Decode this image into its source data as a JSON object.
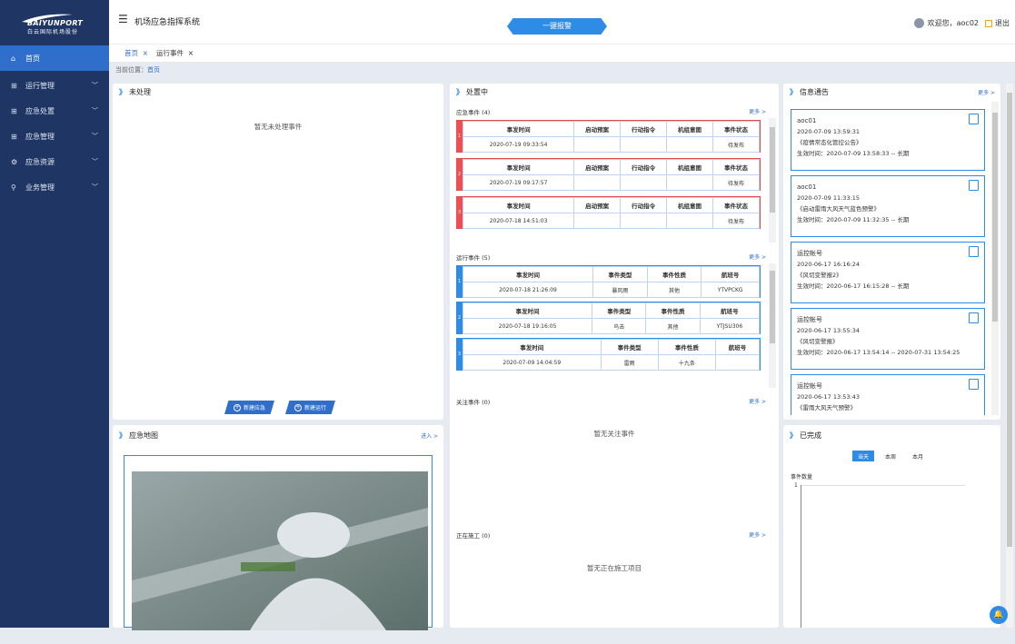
{
  "brand": {
    "logo_en": "BAIYUNPORT",
    "logo_cn": "白云国际机场股份"
  },
  "header": {
    "system_title": "机场应急指挥系统",
    "alarm_button": "一键报警",
    "welcome": "欢迎您，aoc02",
    "logout": "退出"
  },
  "tabs": [
    {
      "label": "首页",
      "close": "×"
    },
    {
      "label": "运行事件",
      "close": "×"
    }
  ],
  "breadcrumb": {
    "prefix": "当前位置：",
    "current": "首页"
  },
  "sidebar": {
    "items": [
      {
        "label": "首页",
        "icon": "home-icon"
      },
      {
        "label": "运行管理",
        "icon": "grid-icon"
      },
      {
        "label": "应急处置",
        "icon": "grid-icon"
      },
      {
        "label": "应急管理",
        "icon": "grid-icon"
      },
      {
        "label": "应急资源",
        "icon": "gear-icon"
      },
      {
        "label": "业务管理",
        "icon": "search-icon"
      }
    ]
  },
  "unprocessed": {
    "title": "未处理",
    "empty": "暂无未处理事件",
    "btn_new_emergency": "新建应急",
    "btn_new_operation": "新建运行"
  },
  "processing": {
    "title": "处置中",
    "more": "更多 >",
    "emergency_title": "应急事件 (4)",
    "emergency_headers": [
      "事发时间",
      "启动预案",
      "行动指令",
      "机组意图",
      "事件状态"
    ],
    "emergency_rows": [
      {
        "idx": "1",
        "time": "2020-07-19 09:33:54",
        "status": "待发布"
      },
      {
        "idx": "2",
        "time": "2020-07-19 09:17:57",
        "status": "待发布"
      },
      {
        "idx": "3",
        "time": "2020-07-18 14:51:03",
        "status": "待发布"
      }
    ],
    "operation_title": "运行事件 (5)",
    "operation_headers": [
      "事发时间",
      "事件类型",
      "事件性质",
      "航班号"
    ],
    "operation_rows": [
      {
        "idx": "1",
        "time": "2020-07-18 21:26:09",
        "type": "暴风雨",
        "nature": "其他",
        "flight": "YTVPCKG"
      },
      {
        "idx": "2",
        "time": "2020-07-18 19:16:05",
        "type": "鸟击",
        "nature": "其他",
        "flight": "YTJSU306"
      },
      {
        "idx": "3",
        "time": "2020-07-09 14:04:59",
        "type": "雷雨",
        "nature": "十九条",
        "flight": ""
      }
    ],
    "follow_title": "关注事件 (0)",
    "follow_empty": "暂无关注事件",
    "construction_title": "正在施工 (0)",
    "construction_empty": "暂无正在施工项目"
  },
  "info": {
    "title": "信息通告",
    "more": "更多 >",
    "notices": [
      {
        "author": "aoc01",
        "date": "2020-07-09 13:59:31",
        "name": "《疫情常态化管控公告》",
        "valid": "生效时间：2020-07-09 13:58:33 -- 长期"
      },
      {
        "author": "aoc01",
        "date": "2020-07-09 11:33:15",
        "name": "《启动雷雨大风天气蓝色预警》",
        "valid": "生效时间：2020-07-09 11:32:35 -- 长期"
      },
      {
        "author": "运控帐号",
        "date": "2020-06-17 16:16:24",
        "name": "《风切变警报2》",
        "valid": "生效时间：2020-06-17 16:15:28 -- 长期"
      },
      {
        "author": "运控帐号",
        "date": "2020-06-17 13:55:34",
        "name": "《风切变警报》",
        "valid": "生效时间：2020-06-17 13:54:14 -- 2020-07-31 13:54:25"
      },
      {
        "author": "运控帐号",
        "date": "2020-06-17 13:53:43",
        "name": "《雷雨大风天气预警》",
        "valid": ""
      }
    ]
  },
  "map": {
    "title": "应急地图",
    "enter": "进入 >"
  },
  "completed": {
    "title": "已完成",
    "periods": [
      "当天",
      "本周",
      "本月"
    ],
    "selected": "当天",
    "ylabel": "事件数量",
    "ytick": "1"
  },
  "colors": {
    "sidebar": "#1f3563",
    "accent": "#2f8ce6",
    "alert": "#ef4f52"
  }
}
